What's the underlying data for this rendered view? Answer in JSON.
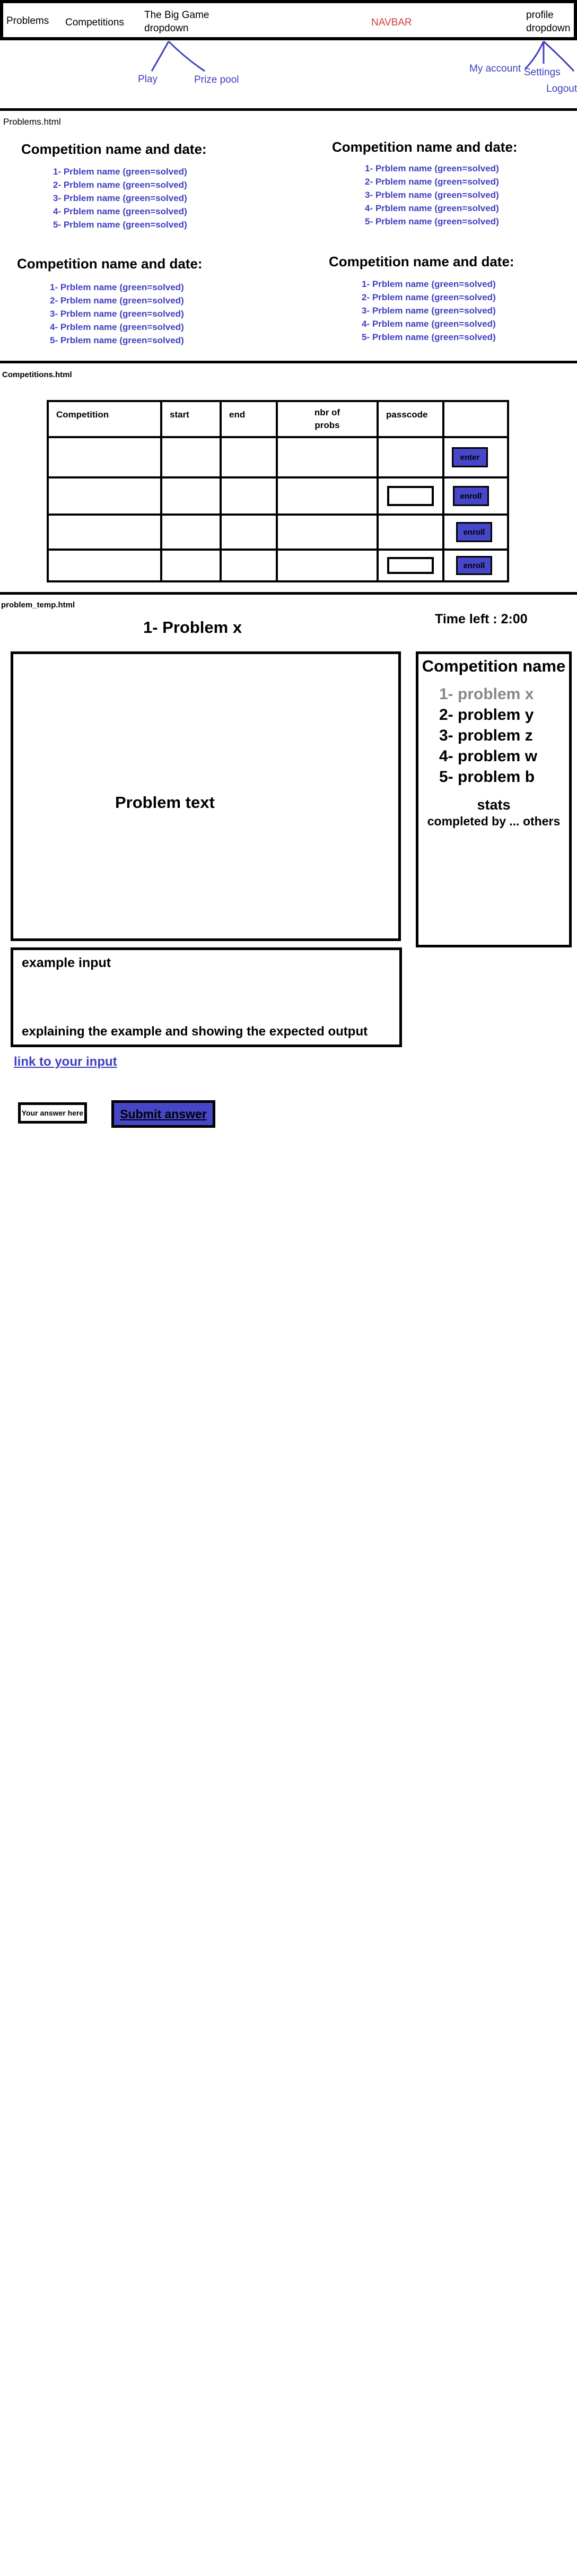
{
  "navbar": {
    "problems": "Problems",
    "competitions": "Competitions",
    "big_game": "The Big Game\ndropdown",
    "navbar_label": "NAVBAR",
    "profile": "profile\ndropdown",
    "play": "Play",
    "prize_pool": "Prize pool",
    "my_account": "My account",
    "settings": "Settings",
    "logout": "Logout"
  },
  "problems_page": {
    "label": "Problems.html",
    "competitions": [
      {
        "title": "Competition name and date:",
        "problems": [
          "1- Prblem name (green=solved)",
          "2- Prblem name (green=solved)",
          "3- Prblem name (green=solved)",
          "4- Prblem name (green=solved)",
          "5-  Prblem name (green=solved)"
        ]
      },
      {
        "title": "Competition name and date:",
        "problems": [
          "1- Prblem name (green=solved)",
          "2- Prblem name (green=solved)",
          "3- Prblem name (green=solved)",
          "4- Prblem name (green=solved)",
          "5-  Prblem name (green=solved)"
        ]
      },
      {
        "title": "Competition name and date:",
        "problems": [
          "1- Prblem name (green=solved)",
          "2- Prblem name (green=solved)",
          "3- Prblem name (green=solved)",
          "4- Prblem name (green=solved)",
          "5- Prblem name (green=solved)"
        ]
      },
      {
        "title": "Competition name and date:",
        "problems": [
          "1- Prblem name (green=solved)",
          "2- Prblem name (green=solved)",
          "3- Prblem name (green=solved)",
          "4- Prblem name (green=solved)",
          "5-  Prblem name (green=solved)"
        ]
      }
    ]
  },
  "competitions_page": {
    "label": "Competitions.html",
    "headers": [
      "Competition",
      "start",
      "end",
      "nbr of\nprobs",
      "passcode",
      ""
    ],
    "rows": [
      {
        "action": "enter",
        "passcode": false
      },
      {
        "action": "enroll",
        "passcode": true
      },
      {
        "action": "enroll",
        "passcode": false
      },
      {
        "action": "enroll",
        "passcode": true
      }
    ]
  },
  "problem_page": {
    "label": "problem_temp.html",
    "title": "1- Problem x",
    "time_left": "Time left : 2:00",
    "problem_text": "Problem text",
    "sidebar": {
      "competition_name": "Competition name",
      "problems": [
        "1- problem x",
        "2- problem y",
        "3- problem z",
        "4- problem w",
        "5- problem b"
      ],
      "stats_title": "stats",
      "stats_text": "completed by ... others"
    },
    "example": {
      "input_label": "example input",
      "explanation": "explaining the example and showing the expected output"
    },
    "link_input": "link to your input",
    "answer_placeholder": "Your answer here",
    "submit": "Submit answer"
  },
  "colors": {
    "accent_blue": "#3f3fc0",
    "button_blue": "#4646c8",
    "navbar_red": "#d04040",
    "current_problem_gray": "#888888"
  }
}
